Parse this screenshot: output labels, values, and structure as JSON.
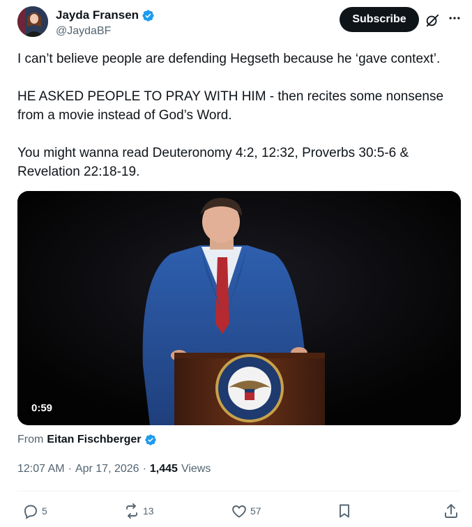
{
  "author": {
    "name": "Jayda Fransen",
    "handle": "@JaydaBF",
    "verified": true
  },
  "header": {
    "subscribe_label": "Subscribe"
  },
  "tweet": {
    "line1": "I can’t believe people are defending Hegseth because he ‘gave context’.",
    "line2": "HE ASKED PEOPLE TO PRAY WITH HIM - then recites some nonsense",
    "line3": "from a movie instead of God’s Word.",
    "line4": "You might wanna read Deuteronomy 4:2, 12:32, Proverbs 30:5-6 &",
    "line5": "Revelation 22:18-19."
  },
  "media": {
    "duration": "0:59",
    "seal_text": "DEPARTMENT OF WAR · UNITED STATES OF AMERICA"
  },
  "source": {
    "prefix": "From",
    "author": "Eitan Fischberger",
    "verified": true
  },
  "meta": {
    "time": "12:07 AM",
    "dot1": "·",
    "date": "Apr 17, 2026",
    "dot2": "·",
    "views_count": "1,445",
    "views_label": "Views"
  },
  "actions": {
    "replies": "5",
    "reposts": "13",
    "likes": "57"
  },
  "colors": {
    "verified": "#1d9bf0",
    "text": "#0f1419",
    "muted": "#536471"
  }
}
